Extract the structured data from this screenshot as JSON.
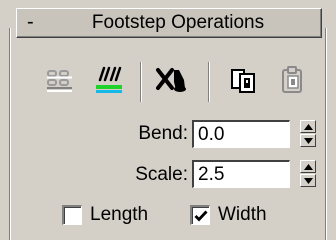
{
  "rollout": {
    "toggle_symbol": "-",
    "title": "Footstep Operations"
  },
  "toolbar": {
    "icons": [
      "create-footsteps-icon",
      "activate-footsteps-icon",
      "delete-footsteps-icon",
      "copy-footsteps-icon",
      "paste-footsteps-icon"
    ]
  },
  "bend": {
    "label": "Bend:",
    "value": "0.0"
  },
  "scale": {
    "label": "Scale:",
    "value": "2.5"
  },
  "options": {
    "length": {
      "label": "Length",
      "checked": false
    },
    "width": {
      "label": "Width",
      "checked": true
    }
  }
}
